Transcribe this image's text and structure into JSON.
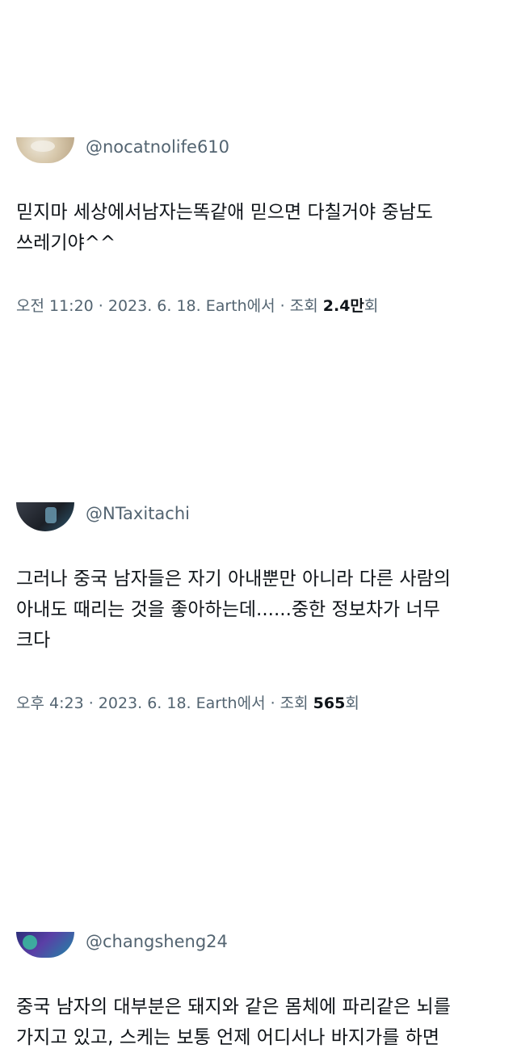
{
  "tweets": [
    {
      "handle": "@nocatnolife610",
      "body_lines": [
        "믿지마 세상에서남자는똑같애 믿으면 다칠거야 중남도",
        "쓰레기야^^"
      ],
      "meta_prefix": "오전 11:20 · 2023. 6. 18. Earth에서 · 조회 ",
      "views": "2.4만",
      "views_suffix": "회"
    },
    {
      "handle": "@NTaxitachi",
      "body_lines": [
        "그러나 중국 남자들은 자기 아내뿐만 아니라 다른 사람의",
        "아내도 때리는 것을 좋아하는데......중한 정보차가 너무",
        "크다"
      ],
      "meta_prefix": "오후 4:23 · 2023. 6. 18. Earth에서 · 조회 ",
      "views": "565",
      "views_suffix": "회"
    },
    {
      "handle": "@changsheng24",
      "body_lines": [
        "중국 남자의 대부분은 돼지와 같은 몸체에 파리같은 뇌를",
        "가지고 있고, 스케는 보통 언제 어디서나 바지가를 하면"
      ]
    }
  ]
}
